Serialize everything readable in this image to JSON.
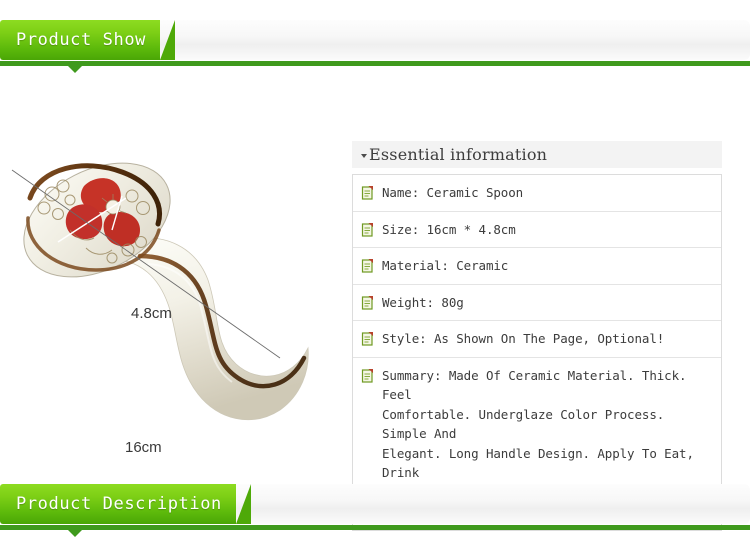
{
  "sections": {
    "top_banner": {
      "label": "Product Show",
      "accent_color": "#5cb90b",
      "rule_color": "#3f9a1d"
    },
    "bottom_banner": {
      "label": "Product Description",
      "accent_color": "#5cb90b",
      "rule_color": "#3f9a1d"
    }
  },
  "product_photo": {
    "alt": "Ceramic spoon with red floral underglaze pattern and long curved handle",
    "dimension_width": "4.8cm",
    "dimension_length": "16cm",
    "glaze_rim_color": "#6b3a16",
    "flower_color": "#c63327",
    "body_color": "#f2f0e8"
  },
  "info_panel": {
    "heading": "Essential information",
    "rows": [
      {
        "icon": "scroll-icon",
        "text": "Name: Ceramic Spoon"
      },
      {
        "icon": "scroll-icon",
        "text": "Size: 16cm * 4.8cm"
      },
      {
        "icon": "scroll-icon",
        "text": "Material: Ceramic"
      },
      {
        "icon": "scroll-icon",
        "text": "Weight: 80g"
      },
      {
        "icon": "scroll-icon",
        "text": "Style: As Shown On The Page, Optional!"
      },
      {
        "icon": "scroll-icon",
        "text": "Summary: Made Of Ceramic Material. Thick. Feel\nComfortable. Underglaze Color Process. Simple And\nElegant. Long Handle Design. Apply To Eat, Drink\nSoup, Porridge. Smooth Does Not Hurt The Mouth"
      }
    ]
  }
}
